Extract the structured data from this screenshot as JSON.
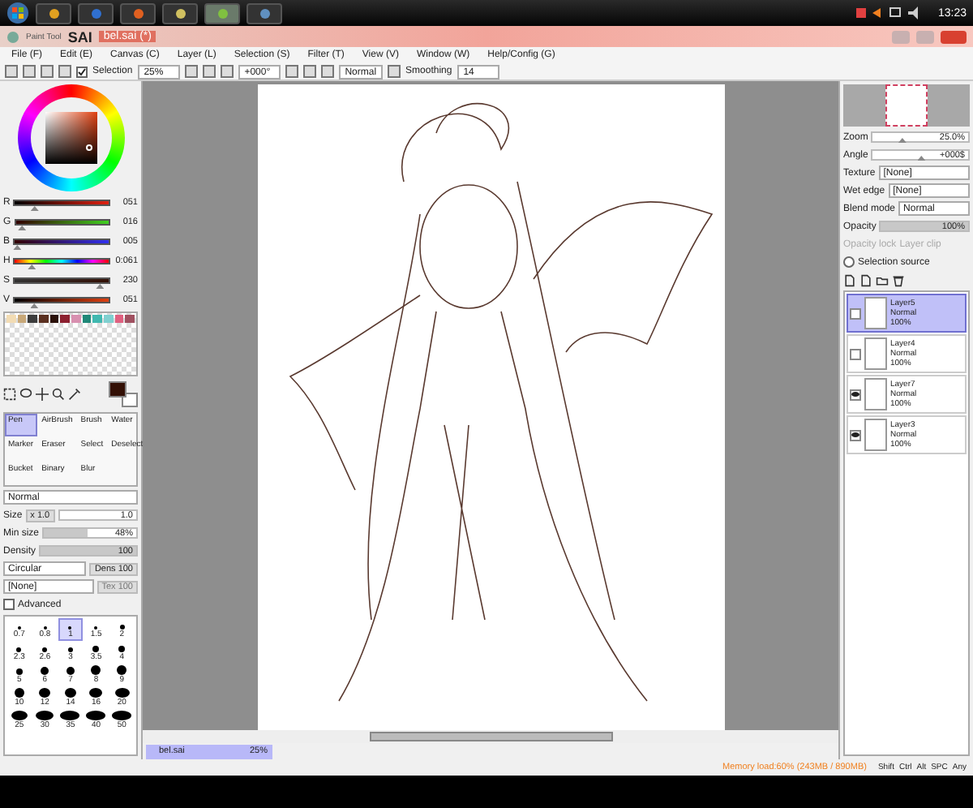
{
  "taskbar": {
    "clock": "13:23"
  },
  "title": {
    "brand": "Paint Tool",
    "app": "SAI",
    "file": "bel.sai (*)"
  },
  "menu": [
    "File (F)",
    "Edit (E)",
    "Canvas (C)",
    "Layer (L)",
    "Selection (S)",
    "Filter (T)",
    "View (V)",
    "Window (W)",
    "Help/Config (G)"
  ],
  "toolbar": {
    "selection": {
      "label": "Selection",
      "checked": true
    },
    "zoom": "25%",
    "angle": "+000°",
    "blend": "Normal",
    "smoothing_label": "Smoothing",
    "smoothing": "14"
  },
  "color_sliders": [
    {
      "label": "R",
      "value": "051",
      "level": 0.2,
      "kind": "r"
    },
    {
      "label": "G",
      "value": "016",
      "level": 0.06,
      "kind": "g"
    },
    {
      "label": "B",
      "value": "005",
      "level": 0.02,
      "kind": "b"
    },
    {
      "label": "H",
      "value": "0:061",
      "level": 0.17,
      "kind": "h"
    },
    {
      "label": "S",
      "value": "230",
      "level": 0.9,
      "kind": "s"
    },
    {
      "label": "V",
      "value": "051",
      "level": 0.2,
      "kind": "v"
    }
  ],
  "swatches": [
    {
      "color": "#f2dcb4"
    },
    {
      "color": "#c8a878"
    },
    {
      "color": "#3c3c3c"
    },
    {
      "color": "#5a3020"
    },
    {
      "color": "#2a1008"
    },
    {
      "color": "#8c2030"
    },
    {
      "color": "#d890b0"
    },
    {
      "color": "#208878"
    },
    {
      "color": "#40b8b0"
    },
    {
      "color": "#80d0d0"
    },
    {
      "color": "#e06080"
    },
    {
      "color": "#a05060"
    }
  ],
  "tools": [
    {
      "label": "Pen",
      "selected": true
    },
    {
      "label": "AirBrush",
      "selected": false
    },
    {
      "label": "Brush",
      "selected": false
    },
    {
      "label": "Water",
      "selected": false
    },
    {
      "label": "Marker",
      "selected": false
    },
    {
      "label": "Eraser",
      "selected": false
    },
    {
      "label": "Select",
      "selected": false
    },
    {
      "label": "Deselect",
      "selected": false
    },
    {
      "label": "Bucket",
      "selected": false
    },
    {
      "label": "Binary",
      "selected": false
    },
    {
      "label": "Blur",
      "selected": false
    }
  ],
  "brush": {
    "mode": "Normal",
    "size_label": "Size",
    "size_mult": "x 1.0",
    "size": "1.0",
    "min_label": "Min size",
    "min_size": {
      "value": "48%",
      "level": 0.48
    },
    "density_label": "Density",
    "density": {
      "value": "100",
      "level": 1
    },
    "shape": "Circular",
    "dens_label": "Dens",
    "dens": "100",
    "texture": "[None]",
    "strength_label": "Tex",
    "strength": "100",
    "advanced": {
      "label": "Advanced",
      "checked": false
    }
  },
  "brush_sizes": [
    {
      "label": "0.7",
      "selected": false
    },
    {
      "label": "0.8",
      "selected": false
    },
    {
      "label": "1",
      "selected": true
    },
    {
      "label": "1.5",
      "selected": false
    },
    {
      "label": "2",
      "selected": false
    },
    {
      "label": "2.3",
      "selected": false
    },
    {
      "label": "2.6",
      "selected": false
    },
    {
      "label": "3",
      "selected": false
    },
    {
      "label": "3.5",
      "selected": false
    },
    {
      "label": "4",
      "selected": false
    },
    {
      "label": "5",
      "selected": false
    },
    {
      "label": "6",
      "selected": false
    },
    {
      "label": "7",
      "selected": false
    },
    {
      "label": "8",
      "selected": false
    },
    {
      "label": "9",
      "selected": false
    },
    {
      "label": "10",
      "selected": false
    },
    {
      "label": "12",
      "selected": false
    },
    {
      "label": "14",
      "selected": false
    },
    {
      "label": "16",
      "selected": false
    },
    {
      "label": "20",
      "selected": false
    },
    {
      "label": "25",
      "selected": false
    },
    {
      "label": "30",
      "selected": false
    },
    {
      "label": "35",
      "selected": false
    },
    {
      "label": "40",
      "selected": false
    },
    {
      "label": "50",
      "selected": false
    }
  ],
  "navigator": {
    "zoom_label": "Zoom",
    "zoom": {
      "value": "25.0%",
      "level": 0.3
    },
    "angle_label": "Angle",
    "angle": {
      "value": "+000$",
      "level": 0.5
    }
  },
  "texture": {
    "label": "Texture",
    "value": "[None]"
  },
  "wet_edge": {
    "label": "Wet edge",
    "value": "[None]"
  },
  "blend": {
    "label": "Blend mode",
    "value": "Normal",
    "opacity_label": "Opacity",
    "opacity": {
      "value": "100%",
      "level": 1
    },
    "opacity_lock": "Opacity lock",
    "layer_clip": "Layer clip",
    "selection_source": {
      "label": "Selection source",
      "selected": false
    }
  },
  "layers": [
    {
      "name": "Layer5",
      "mode": "Normal",
      "opacity": "100%",
      "selected": true,
      "visible": false
    },
    {
      "name": "Layer4",
      "mode": "Normal",
      "opacity": "100%",
      "selected": false,
      "visible": false
    },
    {
      "name": "Layer7",
      "mode": "Normal",
      "opacity": "100%",
      "selected": false,
      "visible": true
    },
    {
      "name": "Layer3",
      "mode": "Normal",
      "opacity": "100%",
      "selected": false,
      "visible": true
    }
  ],
  "doc_tab": {
    "name": "bel.sai",
    "zoom": "25%"
  },
  "status": {
    "memory": "Memory load:60% (243MB / 890MB)",
    "keys": [
      "Shift",
      "Ctrl",
      "Alt",
      "SPC",
      "Any"
    ]
  }
}
